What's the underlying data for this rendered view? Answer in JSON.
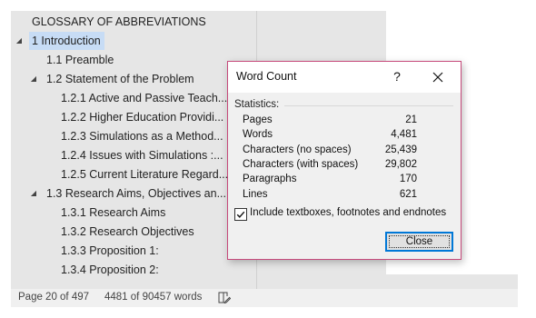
{
  "navigation": {
    "items": [
      {
        "label": "GLOSSARY OF ABBREVIATIONS",
        "level": 0,
        "expander": "none",
        "selected": false
      },
      {
        "label": "1 Introduction",
        "level": 0,
        "expander": "expanded",
        "selected": true
      },
      {
        "label": "1.1 Preamble",
        "level": 1,
        "expander": "none",
        "selected": false
      },
      {
        "label": "1.2 Statement of the Problem",
        "level": 1,
        "expander": "expanded",
        "selected": false
      },
      {
        "label": "1.2.1 Active and Passive Teach...",
        "level": 2,
        "expander": "none",
        "selected": false
      },
      {
        "label": "1.2.2 Higher Education Providi...",
        "level": 2,
        "expander": "none",
        "selected": false
      },
      {
        "label": "1.2.3 Simulations as a Method...",
        "level": 2,
        "expander": "none",
        "selected": false
      },
      {
        "label": "1.2.4 Issues with Simulations :...",
        "level": 2,
        "expander": "none",
        "selected": false
      },
      {
        "label": "1.2.5 Current Literature Regard...",
        "level": 2,
        "expander": "none",
        "selected": false
      },
      {
        "label": "1.3 Research Aims, Objectives an...",
        "level": 1,
        "expander": "expanded",
        "selected": false
      },
      {
        "label": "1.3.1 Research Aims",
        "level": 2,
        "expander": "none",
        "selected": false
      },
      {
        "label": "1.3.2 Research Objectives",
        "level": 2,
        "expander": "none",
        "selected": false
      },
      {
        "label": "1.3.3 Proposition 1:",
        "level": 2,
        "expander": "none",
        "selected": false
      },
      {
        "label": "1.3.4 Proposition 2:",
        "level": 2,
        "expander": "none",
        "selected": false
      }
    ]
  },
  "status_bar": {
    "page": "Page 20 of 497",
    "words": "4481 of 90457 words",
    "proofing_icon": "proofing-book-icon"
  },
  "dialog": {
    "title": "Word Count",
    "help_label": "?",
    "statistics_label": "Statistics:",
    "stats": [
      {
        "name": "Pages",
        "value": "21"
      },
      {
        "name": "Words",
        "value": "4,481"
      },
      {
        "name": "Characters (no spaces)",
        "value": "25,439"
      },
      {
        "name": "Characters (with spaces)",
        "value": "29,802"
      },
      {
        "name": "Paragraphs",
        "value": "170"
      },
      {
        "name": "Lines",
        "value": "621"
      }
    ],
    "include_checkbox": {
      "label": "Include textboxes, footnotes and endnotes",
      "checked": true
    },
    "close_label": "Close"
  },
  "colors": {
    "dialog_border": "#c64a7b",
    "selected_highlight": "#c7dcf5",
    "button_focus": "#0078d7",
    "pane_background": "#e6e6e6"
  }
}
